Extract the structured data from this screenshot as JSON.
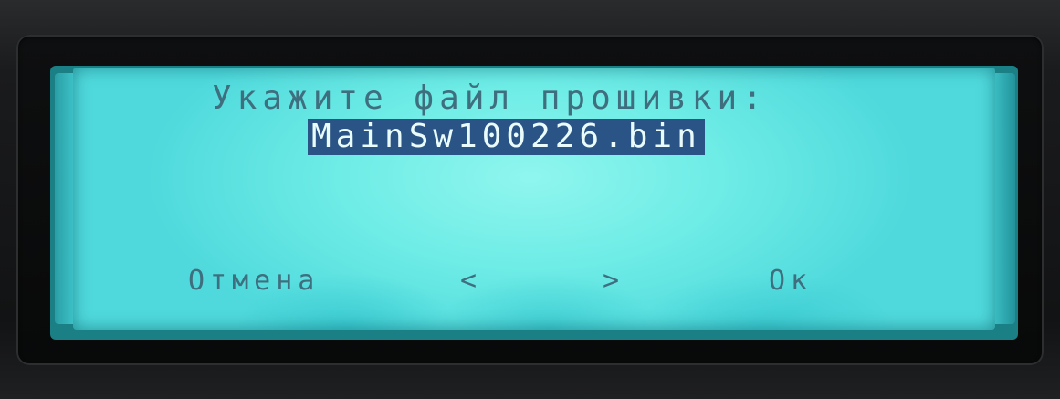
{
  "screen": {
    "prompt": "Укажите файл прошивки:",
    "selected_file": "MainSw100226.bin"
  },
  "softkeys": {
    "cancel": "Отмена",
    "previous": "<",
    "next": ">",
    "ok": "Ок"
  },
  "colors": {
    "lcd_background": "#6eece6",
    "lcd_text": "#3f6f7f",
    "highlight_background": "#2a5486",
    "highlight_text": "#e9fbfb",
    "bezel": "#0e0f10"
  }
}
